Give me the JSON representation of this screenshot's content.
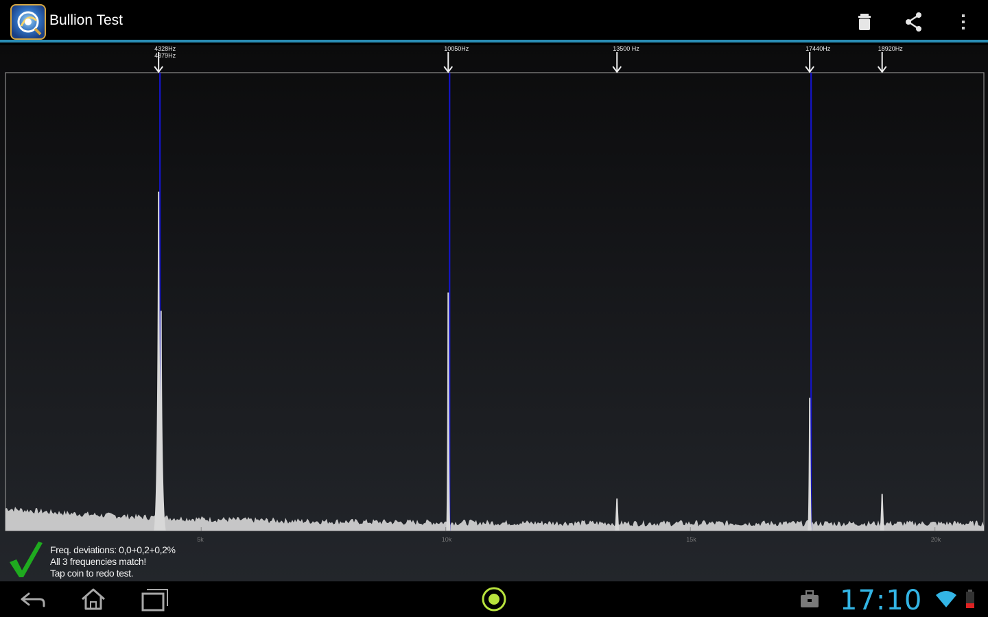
{
  "app": {
    "title": "Bullion Test"
  },
  "action_bar": {
    "icons": [
      "app-logo-icon",
      "trash-icon",
      "share-icon",
      "overflow-menu-icon"
    ],
    "accent_color": "#2a8db5"
  },
  "chart_data": {
    "type": "line",
    "title": "",
    "xlabel": "",
    "ylabel": "",
    "x_ticks": [
      "5k",
      "10k",
      "15k",
      "20k"
    ],
    "x_range": [
      1000,
      21000
    ],
    "peaks": [
      {
        "freq_hz": 4130,
        "label": "4328Hz",
        "height_pct": 74
      },
      {
        "freq_hz": 4180,
        "label": "4379Hz",
        "height_pct": 48
      },
      {
        "freq_hz": 10050,
        "label": "10050Hz",
        "height_pct": 52
      },
      {
        "freq_hz": 13500,
        "label": "13500 Hz",
        "height_pct": 7
      },
      {
        "freq_hz": 17440,
        "label": "17440Hz",
        "height_pct": 29
      },
      {
        "freq_hz": 18920,
        "label": "18920Hz",
        "height_pct": 8
      }
    ],
    "matched_lines_hz": [
      4130,
      10050,
      17440
    ],
    "line_color": "#1414c8",
    "spectrum_color": "#d8d8d8",
    "grid": false
  },
  "status": {
    "line1": "Freq. deviations: 0,0+0,2+0,2%",
    "line2": "All 3 frequencies match!",
    "line3": "Tap coin to redo test.",
    "check_color": "#1faa1f"
  },
  "system_bar": {
    "time": "17:10",
    "clock_color": "#33b5e5",
    "icons": [
      "back-icon",
      "home-icon",
      "recents-icon",
      "center-target-icon",
      "briefcase-icon",
      "wifi-icon",
      "battery-icon"
    ]
  }
}
